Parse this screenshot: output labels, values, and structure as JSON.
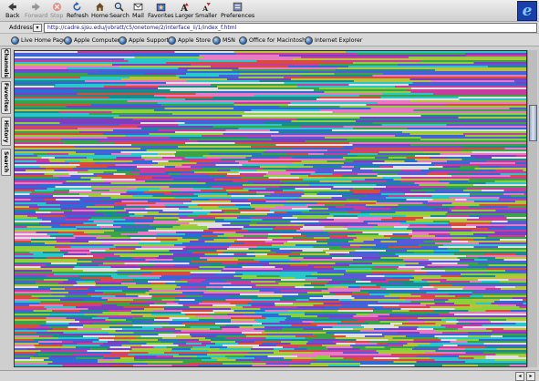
{
  "toolbar": {
    "buttons": [
      {
        "label": "Back",
        "icon": "back-arrow-icon",
        "enabled": true
      },
      {
        "label": "Forward",
        "icon": "forward-arrow-icon",
        "enabled": false
      },
      {
        "label": "Stop",
        "icon": "stop-icon",
        "enabled": false
      },
      {
        "label": "Refresh",
        "icon": "refresh-icon",
        "enabled": true
      },
      {
        "label": "Home",
        "icon": "home-icon",
        "enabled": true
      },
      {
        "label": "Search",
        "icon": "search-icon",
        "enabled": true
      },
      {
        "label": "Mail",
        "icon": "mail-icon",
        "enabled": true
      },
      {
        "label": "Favorites",
        "icon": "favorites-icon",
        "enabled": true
      },
      {
        "label": "Larger",
        "icon": "larger-text-icon",
        "enabled": true
      },
      {
        "label": "Smaller",
        "icon": "smaller-text-icon",
        "enabled": true
      },
      {
        "label": "Preferences",
        "icon": "preferences-icon",
        "enabled": true
      }
    ],
    "logo": "e"
  },
  "address": {
    "label": "Address:",
    "url": "http://cadre.sjsu.edu/jvbratt/c5/onetome/2/interface_ii/1/index_f.html"
  },
  "favorites": [
    "Live Home Page",
    "Apple Computer",
    "Apple Support",
    "Apple Store",
    "MSN",
    "Office for Macintosh",
    "Internet Explorer"
  ],
  "sidebar_tabs": [
    "Channels",
    "Favorites",
    "History",
    "Search"
  ],
  "status": {
    "left": "",
    "zone": "",
    "right": ""
  },
  "colors": {
    "content_palette": [
      "#2f6bd6",
      "#3aa34a",
      "#c83c9e",
      "#8ad13c",
      "#29c7c9",
      "#7b3fbf",
      "#e0e0e0",
      "#d94b3a",
      "#1a8a8a",
      "#5a5ad6",
      "#b8c23a",
      "#e879c4"
    ]
  }
}
